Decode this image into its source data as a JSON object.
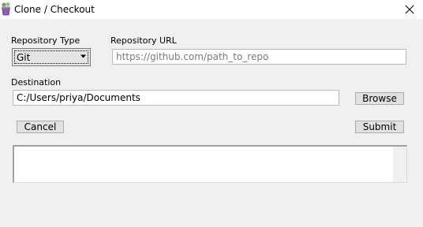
{
  "window": {
    "title": "Clone / Checkout",
    "close_glyph": "✕"
  },
  "repository_type": {
    "label": "Repository Type",
    "selected": "Git"
  },
  "repository_url": {
    "label": "Repository URL",
    "value": "",
    "placeholder": "https://github.com/path_to_repo"
  },
  "destination": {
    "label": "Destination",
    "value": "C:/Users/priya/Documents",
    "browse_label": "Browse"
  },
  "actions": {
    "cancel_label": "Cancel",
    "submit_label": "Submit"
  },
  "output": {
    "text": ""
  },
  "icons": {
    "app": "pot-plant-icon",
    "close": "close-icon",
    "dropdown": "dropdown-arrow-icon"
  }
}
